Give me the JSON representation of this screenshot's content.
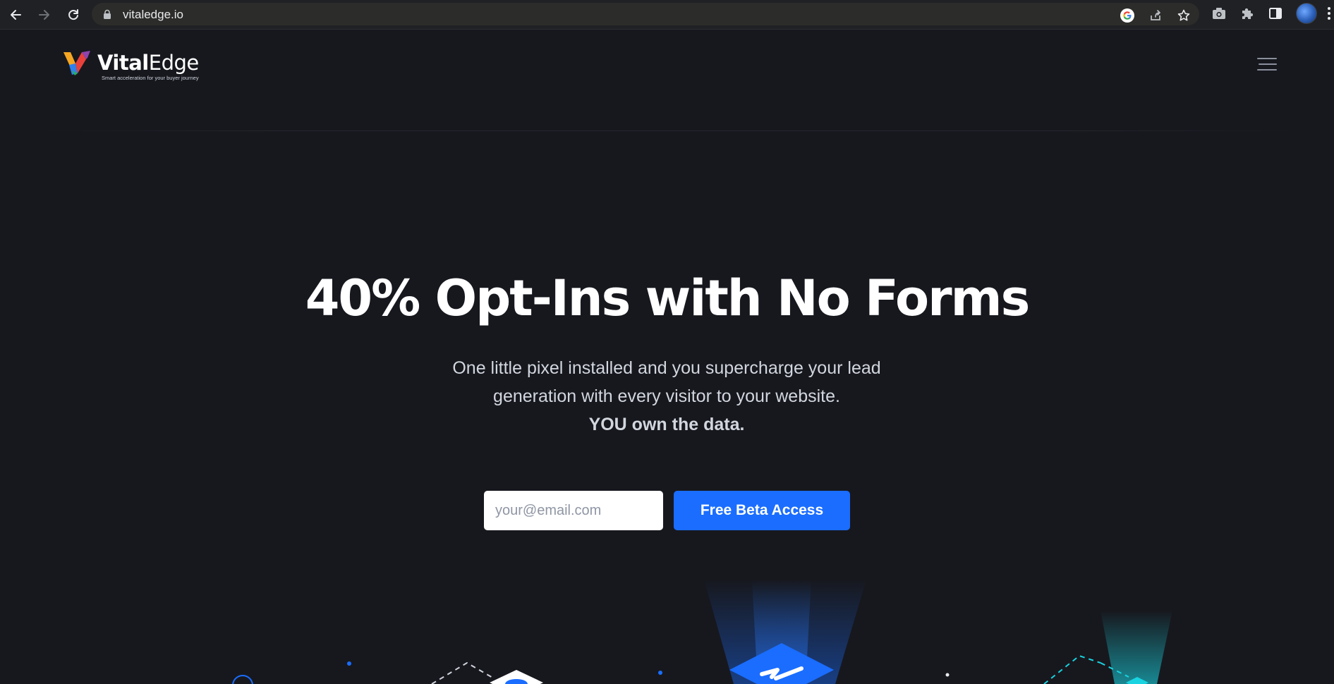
{
  "browser": {
    "url": "vitaledge.io",
    "icons": {
      "back": "back-arrow-icon",
      "forward": "forward-arrow-icon",
      "reload": "reload-icon",
      "lock": "lock-icon",
      "google": "google-icon",
      "share": "share-icon",
      "bookmark": "star-icon",
      "camera": "camera-icon",
      "extensions": "puzzle-icon",
      "side_panel": "side-panel-icon",
      "menu": "kebab-menu-icon"
    }
  },
  "header": {
    "logo": {
      "word_bold": "Vital",
      "word_light": "Edge",
      "tagline": "Smart acceleration for your buyer journey",
      "colors": [
        "#f5a623",
        "#e8413c",
        "#2f80ed",
        "#8e44ad"
      ]
    },
    "menu_icon": "hamburger-menu-icon"
  },
  "hero": {
    "title": "40% Opt-Ins with No Forms",
    "subtitle": "One little pixel installed and you supercharge your lead generation with every visitor to your website.",
    "emphasis": "YOU own the data.",
    "email_placeholder": "your@email.com",
    "email_value": "",
    "cta_label": "Free Beta Access"
  },
  "colors": {
    "background": "#17181e",
    "accent": "#1a6dff",
    "text": "#ffffff",
    "muted": "#d2d6de"
  }
}
